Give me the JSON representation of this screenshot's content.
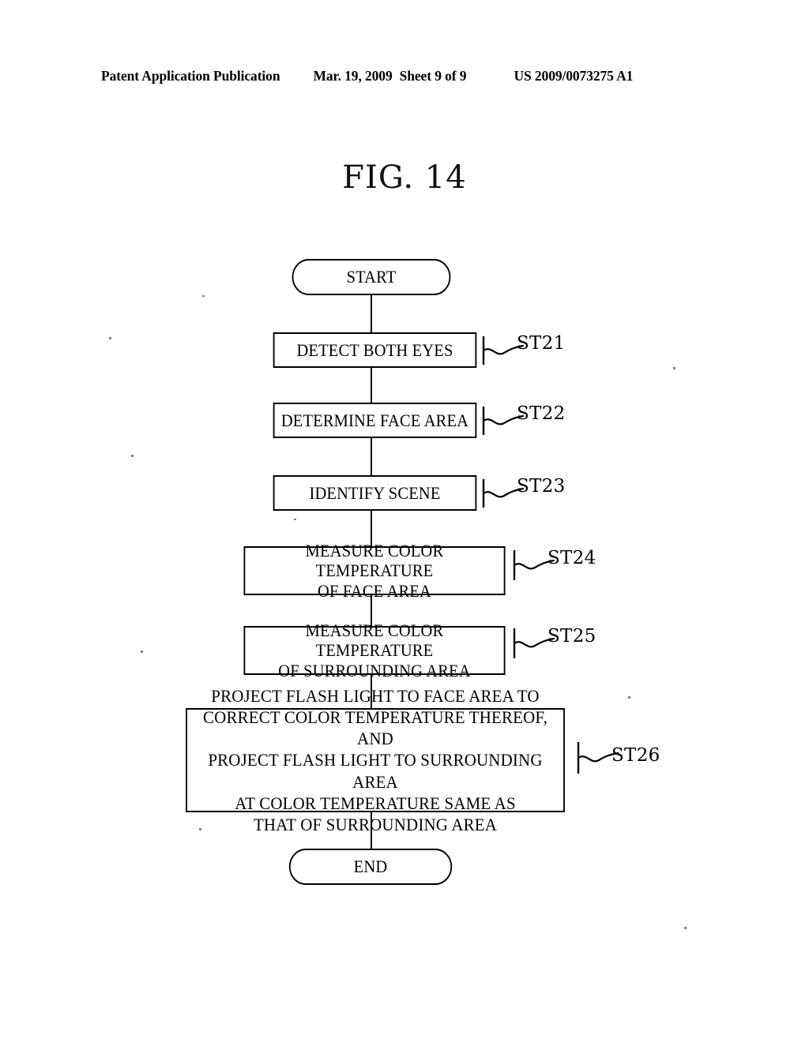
{
  "header": {
    "publication": "Patent Application Publication",
    "date": "Mar. 19, 2009",
    "sheet": "Sheet 9 of 9",
    "patent_number": "US 2009/0073275 A1"
  },
  "figure": {
    "title": "FIG. 14"
  },
  "flowchart": {
    "start_label": "START",
    "end_label": "END",
    "steps": [
      {
        "id": "ST21",
        "text": "DETECT BOTH EYES"
      },
      {
        "id": "ST22",
        "text": "DETERMINE FACE AREA"
      },
      {
        "id": "ST23",
        "text": "IDENTIFY SCENE"
      },
      {
        "id": "ST24",
        "text": "MEASURE COLOR TEMPERATURE\nOF FACE AREA"
      },
      {
        "id": "ST25",
        "text": "MEASURE COLOR TEMPERATURE\nOF SURROUNDING AREA"
      },
      {
        "id": "ST26",
        "text": "PROJECT FLASH LIGHT TO FACE AREA TO\nCORRECT COLOR TEMPERATURE THEREOF, AND\nPROJECT FLASH LIGHT TO SURROUNDING AREA\nAT COLOR TEMPERATURE SAME AS\nTHAT OF SURROUNDING AREA"
      }
    ]
  },
  "colors": {
    "ink": "#000000",
    "paper": "#ffffff"
  }
}
